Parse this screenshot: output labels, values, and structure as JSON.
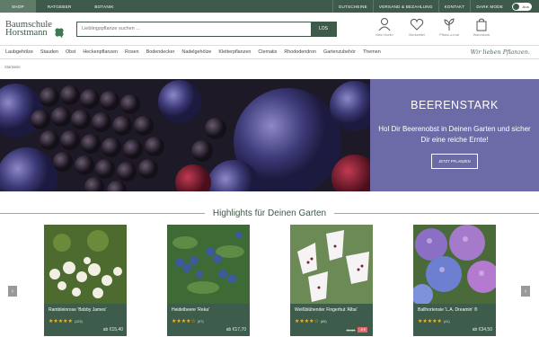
{
  "topbar": {
    "tabs": [
      "Shop",
      "Ratgeber",
      "Botanik"
    ],
    "links": [
      "Gutscheine",
      "Versand & Bezahlung",
      "Kontakt",
      "Dark Mode"
    ],
    "toggle_label": "Aus"
  },
  "header": {
    "logo_line1": "Baumschule",
    "logo_line2": "Horstmann",
    "search_placeholder": "Lieblingspflanze suchen ...",
    "search_button": "LOS",
    "icons": [
      {
        "label": "Mein Konto",
        "icon": "user-icon"
      },
      {
        "label": "Merkzettel",
        "icon": "heart-icon"
      },
      {
        "label": "Pflanz-o-mat",
        "icon": "plant-icon"
      },
      {
        "label": "Warenkorb",
        "icon": "bag-icon"
      }
    ]
  },
  "nav": {
    "items": [
      "Laubgehölze",
      "Stauden",
      "Obst",
      "Heckenpflanzen",
      "Rosen",
      "Bodendecker",
      "Nadelgehölze",
      "Kletterpflanzen",
      "Clematis",
      "Rhododendron",
      "Gartenzubehör",
      "Themen"
    ],
    "slogan": "Wir lieben Pflanzen."
  },
  "breadcrumb": "Startseite",
  "hero": {
    "title": "BEERENSTARK",
    "text": "Hol Dir Beerenobst in Deinen Garten und sicher Dir eine reiche Ernte!",
    "cta": "Jetzt Pflanzen",
    "panel_color": "#6d6ba7"
  },
  "highlights": {
    "title": "Highlights für Deinen Garten",
    "products": [
      {
        "name": "Rambleinrose 'Bobby James'",
        "stars": "★★★★★",
        "count": "(123)",
        "price": "ab €15,40"
      },
      {
        "name": "Heidelbeere 'Reka'",
        "stars": "★★★★☆",
        "count": "(97)",
        "price": "ab €17,70"
      },
      {
        "name": "Weißblühender Fingerhut 'Alba'",
        "stars": "★★★★☆",
        "count": "(65)",
        "old_price": "€9,30",
        "badge": "-5 €",
        "price": ""
      },
      {
        "name": "Ballhortensie 'L.A. Dreamin' ®",
        "stars": "★★★★★",
        "count": "(41)",
        "price": "ab €34,50"
      }
    ]
  },
  "colors": {
    "brand": "#3d5a4a",
    "accent": "#5e7c68"
  }
}
